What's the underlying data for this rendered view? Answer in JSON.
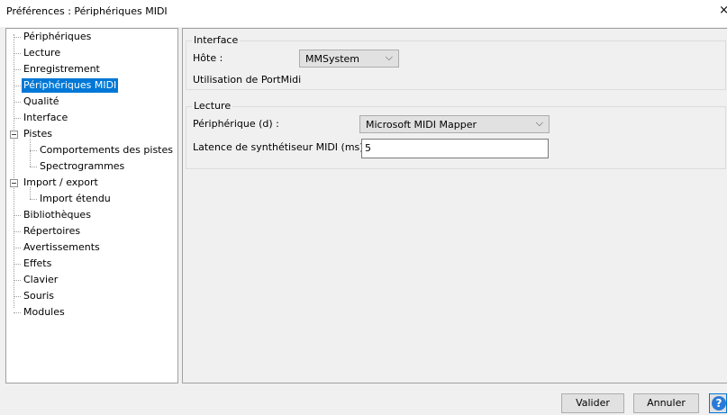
{
  "window": {
    "title": "Préférences : Périphériques MIDI",
    "close_glyph": "×"
  },
  "tree": {
    "items": [
      {
        "label": "Périphériques"
      },
      {
        "label": "Lecture"
      },
      {
        "label": "Enregistrement"
      },
      {
        "label": "Périphériques MIDI",
        "selected": true
      },
      {
        "label": "Qualité"
      },
      {
        "label": "Interface"
      },
      {
        "label": "Pistes",
        "expanded": true
      },
      {
        "label": "Comportements des pistes"
      },
      {
        "label": "Spectrogrammes"
      },
      {
        "label": "Import / export",
        "expanded": true
      },
      {
        "label": "Import étendu"
      },
      {
        "label": "Bibliothèques"
      },
      {
        "label": "Répertoires"
      },
      {
        "label": "Avertissements"
      },
      {
        "label": "Effets"
      },
      {
        "label": "Clavier"
      },
      {
        "label": "Souris"
      },
      {
        "label": "Modules"
      }
    ]
  },
  "interface_group": {
    "title": "Interface",
    "host_label": "Hôte :",
    "host_value": "MMSystem",
    "portmidi_text": "Utilisation de PortMidi"
  },
  "playback_group": {
    "title": "Lecture",
    "device_label": "Périphérique (d) :",
    "device_value": "Microsoft MIDI Mapper",
    "latency_label": "Latence de synthétiseur MIDI (ms) :",
    "latency_value": "5"
  },
  "buttons": {
    "ok": "Valider",
    "cancel": "Annuler",
    "help": "?"
  },
  "colors": {
    "selection": "#0078d7",
    "help_icon": "#2b7bd6"
  }
}
